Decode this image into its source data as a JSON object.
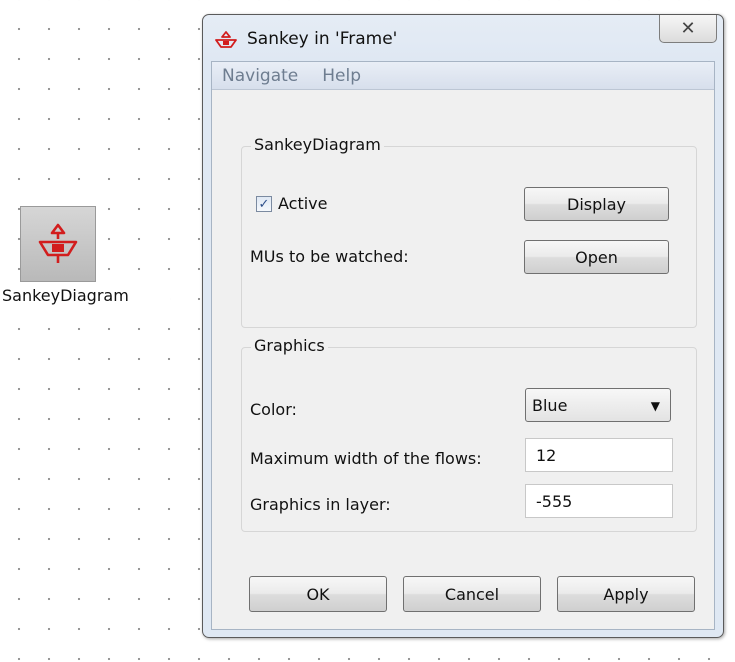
{
  "canvas": {
    "object_label": "SankeyDiagram",
    "object_icon": "sankey-icon"
  },
  "window": {
    "title": "Sankey in 'Frame'",
    "title_icon": "sankey-icon",
    "close_glyph": "✕"
  },
  "menu": {
    "items": [
      "Navigate",
      "Help"
    ]
  },
  "sankey_group": {
    "title": "SankeyDiagram",
    "active_label": "Active",
    "active_checked": true,
    "check_glyph": "✓",
    "display_button": "Display",
    "mus_label": "MUs to be watched:",
    "open_button": "Open"
  },
  "graphics_group": {
    "title": "Graphics",
    "color_label": "Color:",
    "color_value": "Blue",
    "color_caret": "▼",
    "max_width_label": "Maximum width of the flows:",
    "max_width_value": "12",
    "layer_label": "Graphics in layer:",
    "layer_value": "-555"
  },
  "footer": {
    "ok": "OK",
    "cancel": "Cancel",
    "apply": "Apply"
  },
  "colors": {
    "icon_red": "#d21d1d",
    "menu_text": "#6e7d90",
    "window_border": "#5a5a5a"
  }
}
